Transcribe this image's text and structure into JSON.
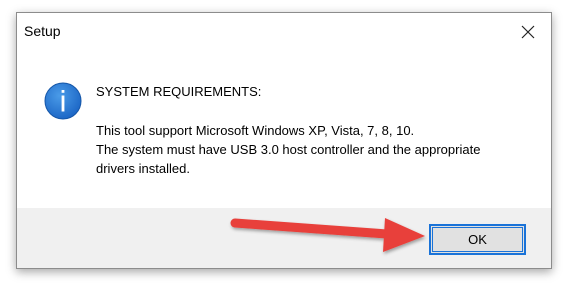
{
  "window": {
    "title": "Setup",
    "close_icon": "close-icon"
  },
  "message": {
    "icon": "info-icon",
    "heading": "SYSTEM REQUIREMENTS:",
    "lines": [
      "This tool support Microsoft Windows XP, Vista, 7, 8, 10.",
      "The system must have USB 3.0 host controller and the appropriate",
      "drivers installed."
    ]
  },
  "buttons": {
    "ok_label": "OK"
  },
  "colors": {
    "accent": "#1a73d8",
    "info_icon": "#1f74d0",
    "arrow": "#e8403a"
  }
}
